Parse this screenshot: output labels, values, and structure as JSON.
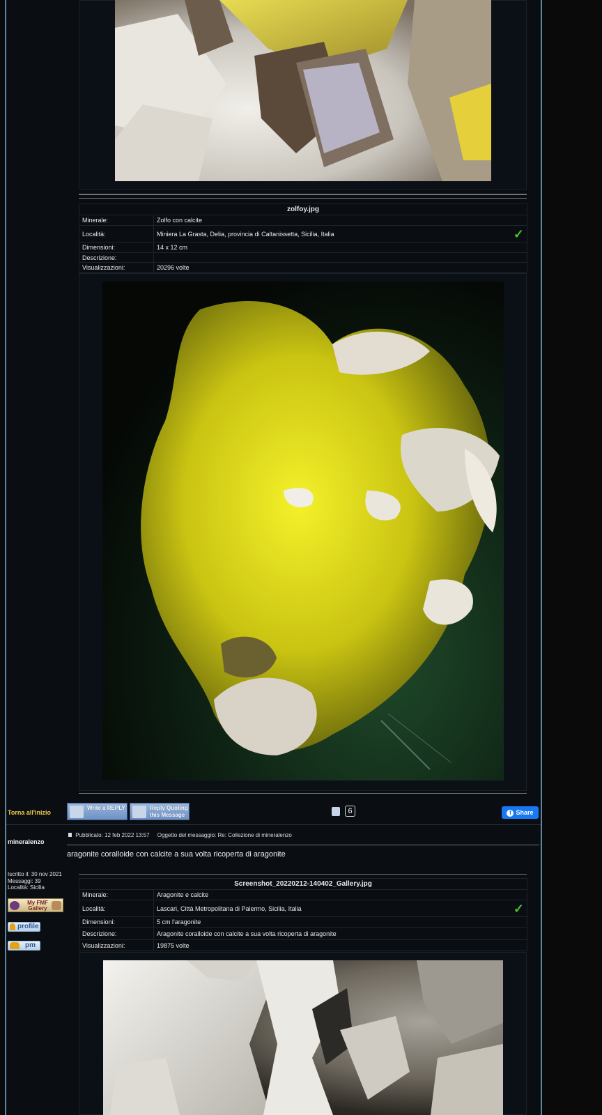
{
  "post1": {
    "image_title": "zolfoy.jpg",
    "rows": [
      {
        "key": "Minerale:",
        "value": "Zolfo con calcite"
      },
      {
        "key": "Località:",
        "value": "Miniera La Grasta, Delia, provincia di Caltanissetta, Sicilia, Italia",
        "check": true
      },
      {
        "key": "Dimensioni:",
        "value": "14 x 12 cm"
      },
      {
        "key": "Descrizione:",
        "value": ""
      },
      {
        "key": "Visualizzazioni:",
        "value": "20296 volte"
      }
    ]
  },
  "actions": {
    "back_to_top": "Torna all'inizio",
    "write_reply": "Write a REPLY",
    "reply_quoting": "Reply Quoting this Message",
    "like_count": "6",
    "share": "Share"
  },
  "post2": {
    "author": "mineralenzo",
    "published": "Pubblicato: 12 feb 2022 13:57",
    "subject": "Oggetto del messaggio: Re: Collezione di mineralenzo",
    "body": "aragonite coralloide con calcite a sua volta ricoperta di aragonite",
    "author_info": [
      "Iscritto il: 30 nov 2021",
      "Messaggi: 39",
      "Località: Sicilia"
    ],
    "gallery_badge": "My FMF Gallery",
    "profile_btn": "profile",
    "pm_btn": "pm",
    "image_title": "Screenshot_20220212-140402_Gallery.jpg",
    "rows": [
      {
        "key": "Minerale:",
        "value": "Aragonite e calcite"
      },
      {
        "key": "Località:",
        "value": "Lascari, Città Metropolitana di Palermo, Sicilia, Italia",
        "check": true
      },
      {
        "key": "Dimensioni:",
        "value": "5 cm l'aragonite"
      },
      {
        "key": "Descrizione:",
        "value": "Aragonite coralloide con calcite a sua volta ricoperta di aragonite"
      },
      {
        "key": "Visualizzazioni:",
        "value": "19875 volte"
      }
    ]
  },
  "colors": {
    "frame_border": "#5a86a8",
    "back_to_top": "#f0c94a",
    "check": "#46c62a",
    "facebook": "#1877f2"
  }
}
